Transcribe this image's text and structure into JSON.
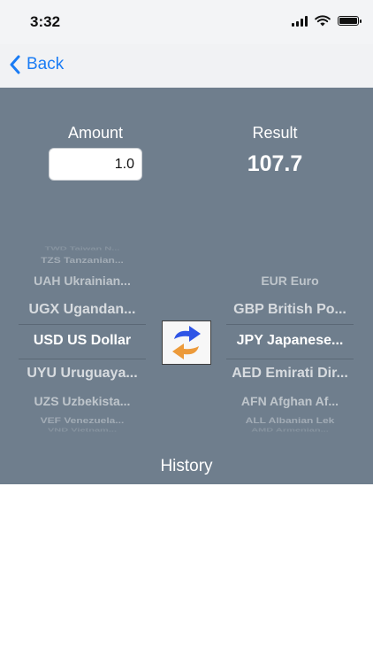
{
  "status": {
    "time": "3:32"
  },
  "nav": {
    "back_label": "Back"
  },
  "converter": {
    "amount_label": "Amount",
    "amount_value": "1.0",
    "result_label": "Result",
    "result_value": "107.7"
  },
  "from_picker": {
    "items": [
      "TWD Taiwan N...",
      "TZS Tanzanian...",
      "UAH Ukrainian...",
      "UGX Ugandan...",
      "USD US Dollar",
      "UYU Uruguaya...",
      "UZS Uzbekista...",
      "VEF Venezuela...",
      "VND Vietnam..."
    ],
    "selected": "USD US Dollar"
  },
  "to_picker": {
    "items": [
      "EUR Euro",
      "GBP British Po...",
      "JPY Japanese...",
      "AED Emirati Dir...",
      "AFN Afghan Af...",
      "ALL Albanian Lek",
      "AMD Armenian..."
    ],
    "selected": "JPY Japanese..."
  },
  "swap": {
    "icon": "swap-arrows-icon"
  },
  "footer": {
    "history_label": "History"
  }
}
